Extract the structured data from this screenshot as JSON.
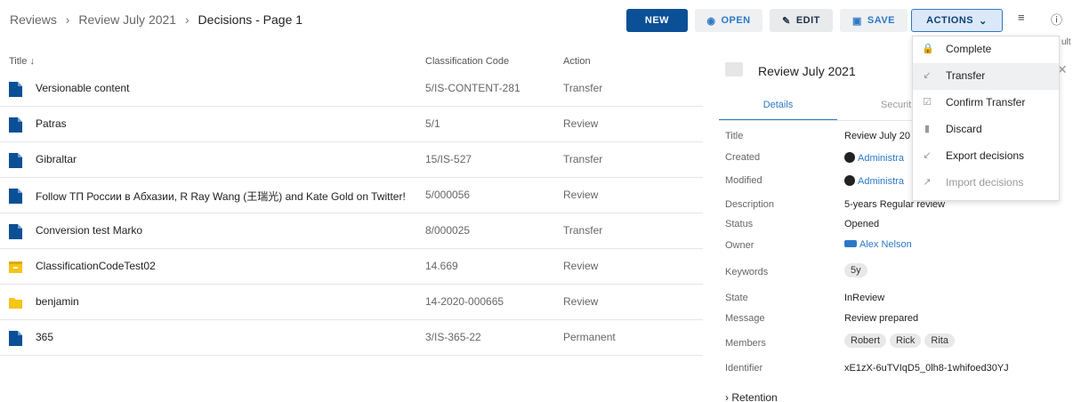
{
  "breadcrumb": {
    "item1": "Reviews",
    "item2": "Review July 2021",
    "current": "Decisions - Page 1",
    "sep": "›"
  },
  "toolbar": {
    "new": "NEW",
    "open": "OPEN",
    "edit": "EDIT",
    "save": "SAVE",
    "actions": "ACTIONS",
    "list_icon": "list-icon",
    "info_icon": "info-icon"
  },
  "table": {
    "headers": {
      "title": "Title",
      "code": "Classification Code",
      "action": "Action"
    },
    "rows": [
      {
        "title": "Versionable content",
        "code": "5/IS-CONTENT-281",
        "action": "Transfer",
        "icon": "file"
      },
      {
        "title": "Patras",
        "code": "5/1",
        "action": "Review",
        "icon": "file"
      },
      {
        "title": "Gibraltar",
        "code": "15/IS-527",
        "action": "Transfer",
        "icon": "file"
      },
      {
        "title": "Follow ТП России в Абхазии, R Ray Wang (王瑞光) and Kate Gold on Twitter!",
        "code": "5/000056",
        "action": "Review",
        "icon": "file"
      },
      {
        "title": "Conversion test Marko",
        "code": "8/000025",
        "action": "Transfer",
        "icon": "file"
      },
      {
        "title": "ClassificationCodeTest02",
        "code": "14.669",
        "action": "Review",
        "icon": "archive"
      },
      {
        "title": "benjamin",
        "code": "14-2020-000665",
        "action": "Review",
        "icon": "folder"
      },
      {
        "title": "365",
        "code": "3/IS-365-22",
        "action": "Permanent",
        "icon": "file"
      }
    ]
  },
  "panel": {
    "title": "Review July 2021",
    "tab_details": "Details",
    "tab_security": "Securit",
    "fields": {
      "title_label": "Title",
      "title_value": "Review July 20",
      "created_label": "Created",
      "created_value": "Administra",
      "modified_label": "Modified",
      "modified_value": "Administra",
      "description_label": "Description",
      "description_value": "5-years Regular review",
      "status_label": "Status",
      "status_value": "Opened",
      "owner_label": "Owner",
      "owner_value": "Alex Nelson",
      "keywords_label": "Keywords",
      "keyword": "5y",
      "state_label": "State",
      "state_value": "InReview",
      "message_label": "Message",
      "message_value": "Review prepared",
      "members_label": "Members",
      "members": [
        "Robert",
        "Rick",
        "Rita"
      ],
      "identifier_label": "Identifier",
      "identifier_value": "xE1zX-6uTVIqD5_0lh8-1whifoed30YJ",
      "retention_label": "Retention"
    },
    "overflow_text": "ult"
  },
  "menu": {
    "items": [
      {
        "label": "Complete",
        "icon": "lock-icon"
      },
      {
        "label": "Transfer",
        "icon": "arrow-down-left-icon"
      },
      {
        "label": "Confirm Transfer",
        "icon": "check-box-icon"
      },
      {
        "label": "Discard",
        "icon": "trash-icon"
      },
      {
        "label": "Export decisions",
        "icon": "arrow-down-left-icon"
      },
      {
        "label": "Import decisions",
        "icon": "arrow-up-right-icon"
      }
    ]
  },
  "colors": {
    "primary": "#0b4f96",
    "accent": "#2c78c6",
    "file": "#0b4f96",
    "folder": "#f5c518"
  }
}
